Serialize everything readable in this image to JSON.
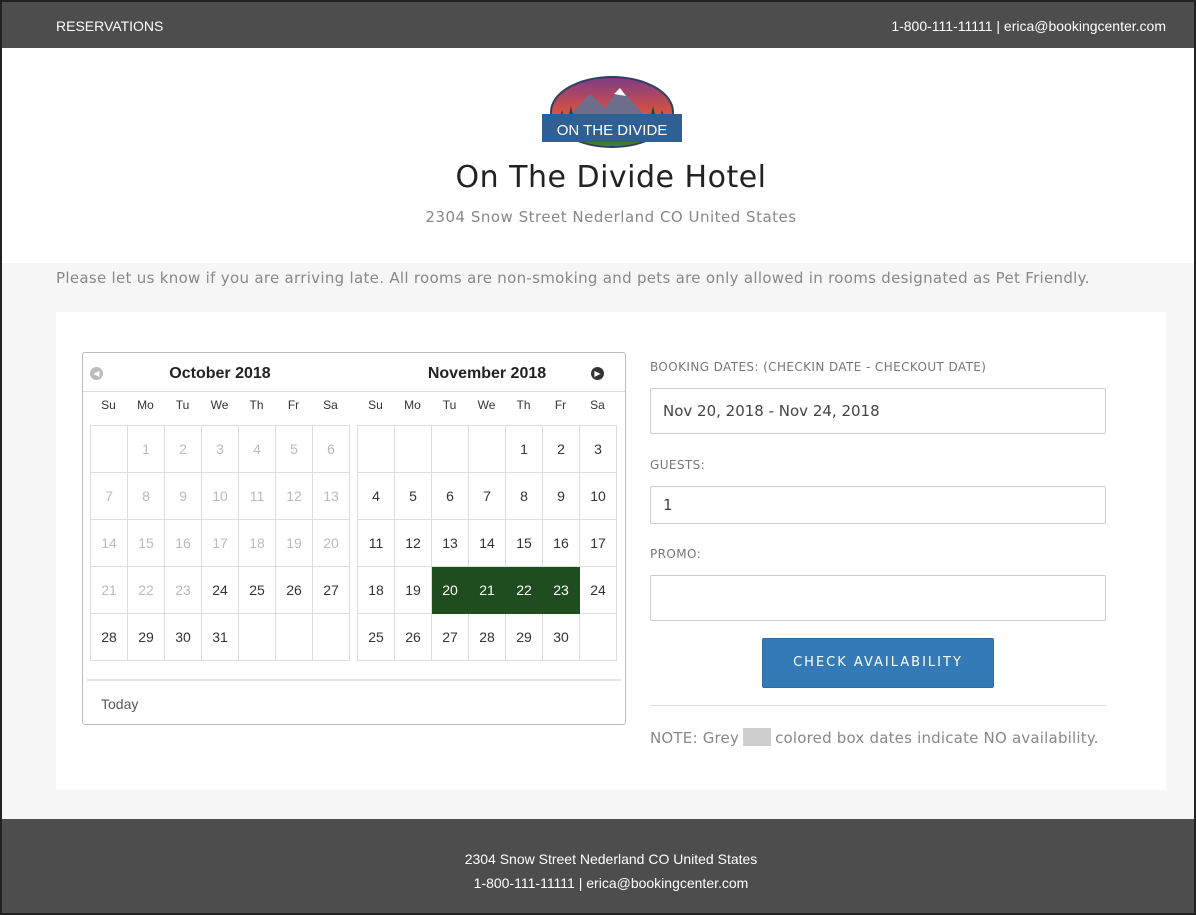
{
  "topbar": {
    "title": "RESERVATIONS",
    "contact": "1-800-111-11111 |  erica@bookingcenter.com"
  },
  "hero": {
    "logo_text": "ON THE DIVIDE",
    "name": "On The Divide Hotel",
    "address": "2304 Snow Street Nederland CO United States"
  },
  "notice": "Please let us know if you are arriving late. All rooms are non-smoking and pets are only allowed in rooms designated as Pet Friendly.",
  "calendar": {
    "prev_icon": "chevron-left-icon",
    "next_icon": "chevron-right-icon",
    "dow": [
      "Su",
      "Mo",
      "Tu",
      "We",
      "Th",
      "Fr",
      "Sa"
    ],
    "months": [
      {
        "title": "October 2018",
        "weeks": [
          [
            {
              "d": "",
              "s": "empty"
            },
            {
              "d": "1",
              "s": "muted"
            },
            {
              "d": "2",
              "s": "muted"
            },
            {
              "d": "3",
              "s": "muted"
            },
            {
              "d": "4",
              "s": "muted"
            },
            {
              "d": "5",
              "s": "muted"
            },
            {
              "d": "6",
              "s": "muted"
            }
          ],
          [
            {
              "d": "7",
              "s": "muted"
            },
            {
              "d": "8",
              "s": "muted"
            },
            {
              "d": "9",
              "s": "muted"
            },
            {
              "d": "10",
              "s": "muted"
            },
            {
              "d": "11",
              "s": "muted"
            },
            {
              "d": "12",
              "s": "muted"
            },
            {
              "d": "13",
              "s": "muted"
            }
          ],
          [
            {
              "d": "14",
              "s": "muted"
            },
            {
              "d": "15",
              "s": "muted"
            },
            {
              "d": "16",
              "s": "muted"
            },
            {
              "d": "17",
              "s": "muted"
            },
            {
              "d": "18",
              "s": "muted"
            },
            {
              "d": "19",
              "s": "muted"
            },
            {
              "d": "20",
              "s": "muted"
            }
          ],
          [
            {
              "d": "21",
              "s": "muted"
            },
            {
              "d": "22",
              "s": "muted"
            },
            {
              "d": "23",
              "s": "muted"
            },
            {
              "d": "24",
              "s": ""
            },
            {
              "d": "25",
              "s": ""
            },
            {
              "d": "26",
              "s": ""
            },
            {
              "d": "27",
              "s": ""
            }
          ],
          [
            {
              "d": "28",
              "s": ""
            },
            {
              "d": "29",
              "s": ""
            },
            {
              "d": "30",
              "s": ""
            },
            {
              "d": "31",
              "s": ""
            },
            {
              "d": "",
              "s": "empty"
            },
            {
              "d": "",
              "s": "empty"
            },
            {
              "d": "",
              "s": "empty"
            }
          ]
        ]
      },
      {
        "title": "November 2018",
        "weeks": [
          [
            {
              "d": "",
              "s": "empty"
            },
            {
              "d": "",
              "s": "empty"
            },
            {
              "d": "",
              "s": "empty"
            },
            {
              "d": "",
              "s": "empty"
            },
            {
              "d": "1",
              "s": ""
            },
            {
              "d": "2",
              "s": ""
            },
            {
              "d": "3",
              "s": ""
            }
          ],
          [
            {
              "d": "4",
              "s": ""
            },
            {
              "d": "5",
              "s": ""
            },
            {
              "d": "6",
              "s": ""
            },
            {
              "d": "7",
              "s": ""
            },
            {
              "d": "8",
              "s": ""
            },
            {
              "d": "9",
              "s": ""
            },
            {
              "d": "10",
              "s": ""
            }
          ],
          [
            {
              "d": "11",
              "s": ""
            },
            {
              "d": "12",
              "s": ""
            },
            {
              "d": "13",
              "s": ""
            },
            {
              "d": "14",
              "s": ""
            },
            {
              "d": "15",
              "s": ""
            },
            {
              "d": "16",
              "s": ""
            },
            {
              "d": "17",
              "s": ""
            }
          ],
          [
            {
              "d": "18",
              "s": ""
            },
            {
              "d": "19",
              "s": ""
            },
            {
              "d": "20",
              "s": "selected"
            },
            {
              "d": "21",
              "s": "selected"
            },
            {
              "d": "22",
              "s": "selected"
            },
            {
              "d": "23",
              "s": "selected"
            },
            {
              "d": "24",
              "s": ""
            }
          ],
          [
            {
              "d": "25",
              "s": ""
            },
            {
              "d": "26",
              "s": ""
            },
            {
              "d": "27",
              "s": ""
            },
            {
              "d": "28",
              "s": ""
            },
            {
              "d": "29",
              "s": ""
            },
            {
              "d": "30",
              "s": ""
            },
            {
              "d": "",
              "s": "empty"
            }
          ]
        ]
      }
    ],
    "today_label": "Today",
    "selected_color": "#1f4d1f"
  },
  "form": {
    "dates_label": "BOOKING DATES: (CHECKIN DATE - CHECKOUT DATE)",
    "dates_value": "Nov 20, 2018 - Nov 24, 2018",
    "guests_label": "GUESTS:",
    "guests_value": "1",
    "promo_label": "PROMO:",
    "promo_value": "",
    "button_label": "CHECK AVAILABILITY",
    "button_color": "#337ab7",
    "note_before": "NOTE: Grey",
    "note_after": "colored box dates indicate NO availability."
  },
  "footer": {
    "address": "2304 Snow Street Nederland CO United States",
    "contact": "1-800-111-11111 | erica@bookingcenter.com"
  }
}
